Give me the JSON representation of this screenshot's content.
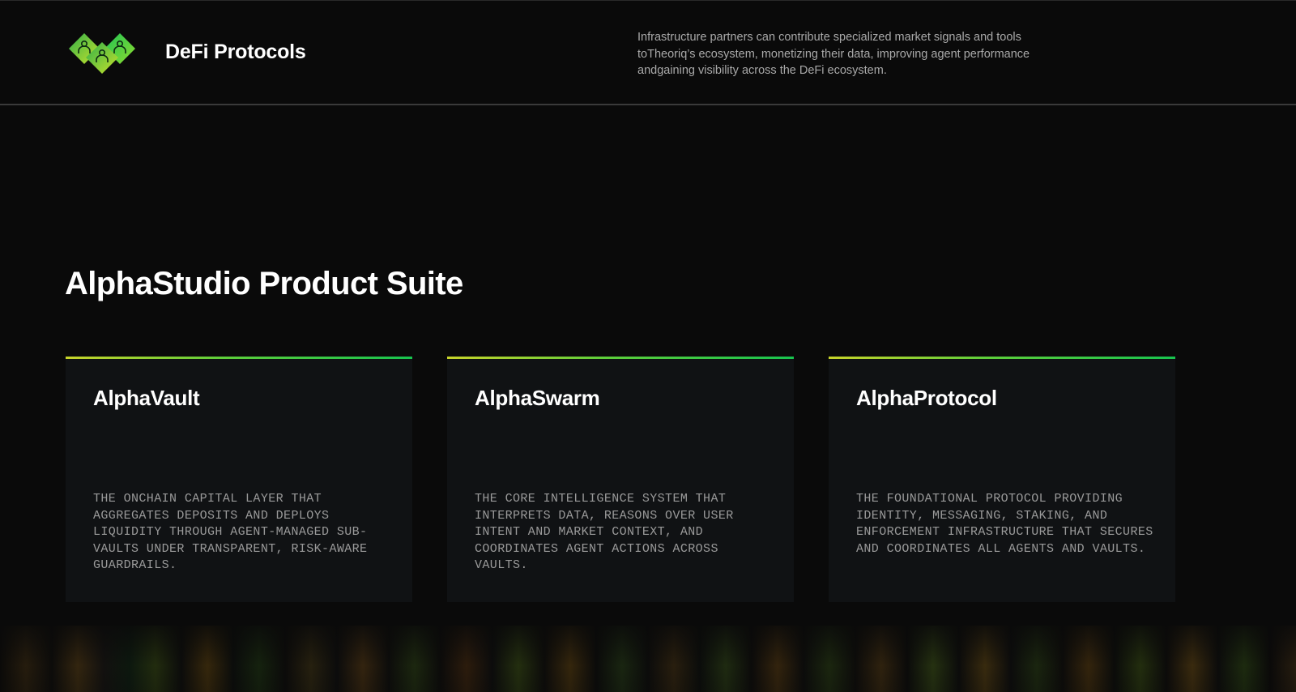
{
  "header": {
    "title": "DeFi Protocols",
    "description": "Infrastructure partners can contribute specialized market signals and tools toTheoriq’s ecosystem, monetizing their data, improving agent performance andgaining visibility across the DeFi ecosystem.",
    "logo_icon": "group-of-people-diamond-icon"
  },
  "section": {
    "title": "AlphaStudio Product Suite"
  },
  "cards": [
    {
      "title": "AlphaVault",
      "description": "THE ONCHAIN CAPITAL LAYER THAT AGGREGATES DEPOSITS AND DEPLOYS LIQUIDITY THROUGH AGENT-MANAGED SUB-VAULTS UNDER TRANSPARENT, RISK-AWARE GUARDRAILS."
    },
    {
      "title": "AlphaSwarm",
      "description": "THE CORE INTELLIGENCE SYSTEM THAT INTERPRETS DATA, REASONS OVER USER INTENT AND MARKET CONTEXT, AND COORDINATES AGENT ACTIONS ACROSS VAULTS."
    },
    {
      "title": "AlphaProtocol",
      "description": "THE FOUNDATIONAL PROTOCOL PROVIDING IDENTITY, MESSAGING, STAKING, AND ENFORCEMENT INFRASTRUCTURE THAT SECURES AND COORDINATES ALL AGENTS AND VAULTS."
    }
  ],
  "colors": {
    "background": "#0a0a0a",
    "card_background": "#101214",
    "accent_start": "#c8d42a",
    "accent_end": "#18c44f",
    "muted_text": "#9a9a9a"
  }
}
